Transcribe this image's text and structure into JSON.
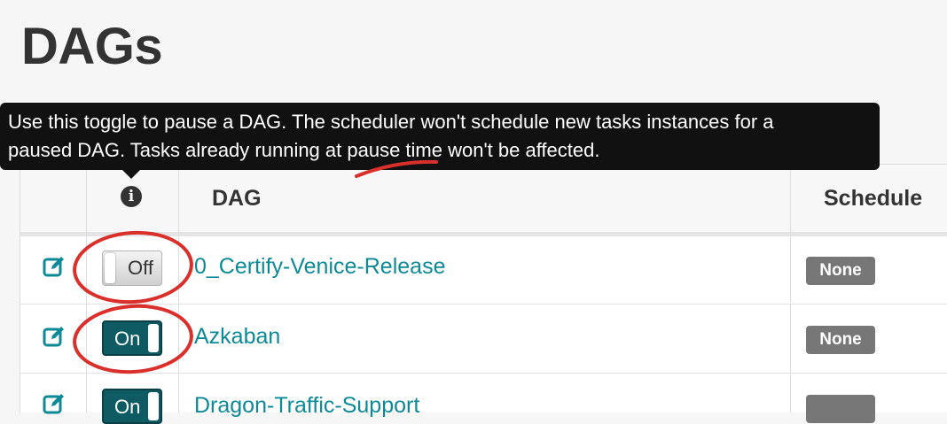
{
  "page": {
    "title": "DAGs"
  },
  "tooltip": {
    "line1": "Use this toggle to pause a DAG. The scheduler won't schedule new tasks instances for a",
    "line2": "paused DAG. Tasks already running at pause time won't be affected."
  },
  "table": {
    "headers": {
      "info_icon": "info-icon",
      "dag": "DAG",
      "schedule": "Schedule"
    },
    "rows": [
      {
        "toggle": "Off",
        "dag": "0_Certify-Venice-Release",
        "schedule": "None"
      },
      {
        "toggle": "On",
        "dag": "Azkaban",
        "schedule": "None"
      },
      {
        "toggle": "On",
        "dag": "Dragon-Traffic-Support",
        "schedule": ""
      }
    ]
  },
  "colors": {
    "link": "#0e8a96",
    "toggle_on": "#0f5b63",
    "badge": "#777777",
    "annotation": "#d9302c",
    "tooltip_bg": "#111111"
  }
}
